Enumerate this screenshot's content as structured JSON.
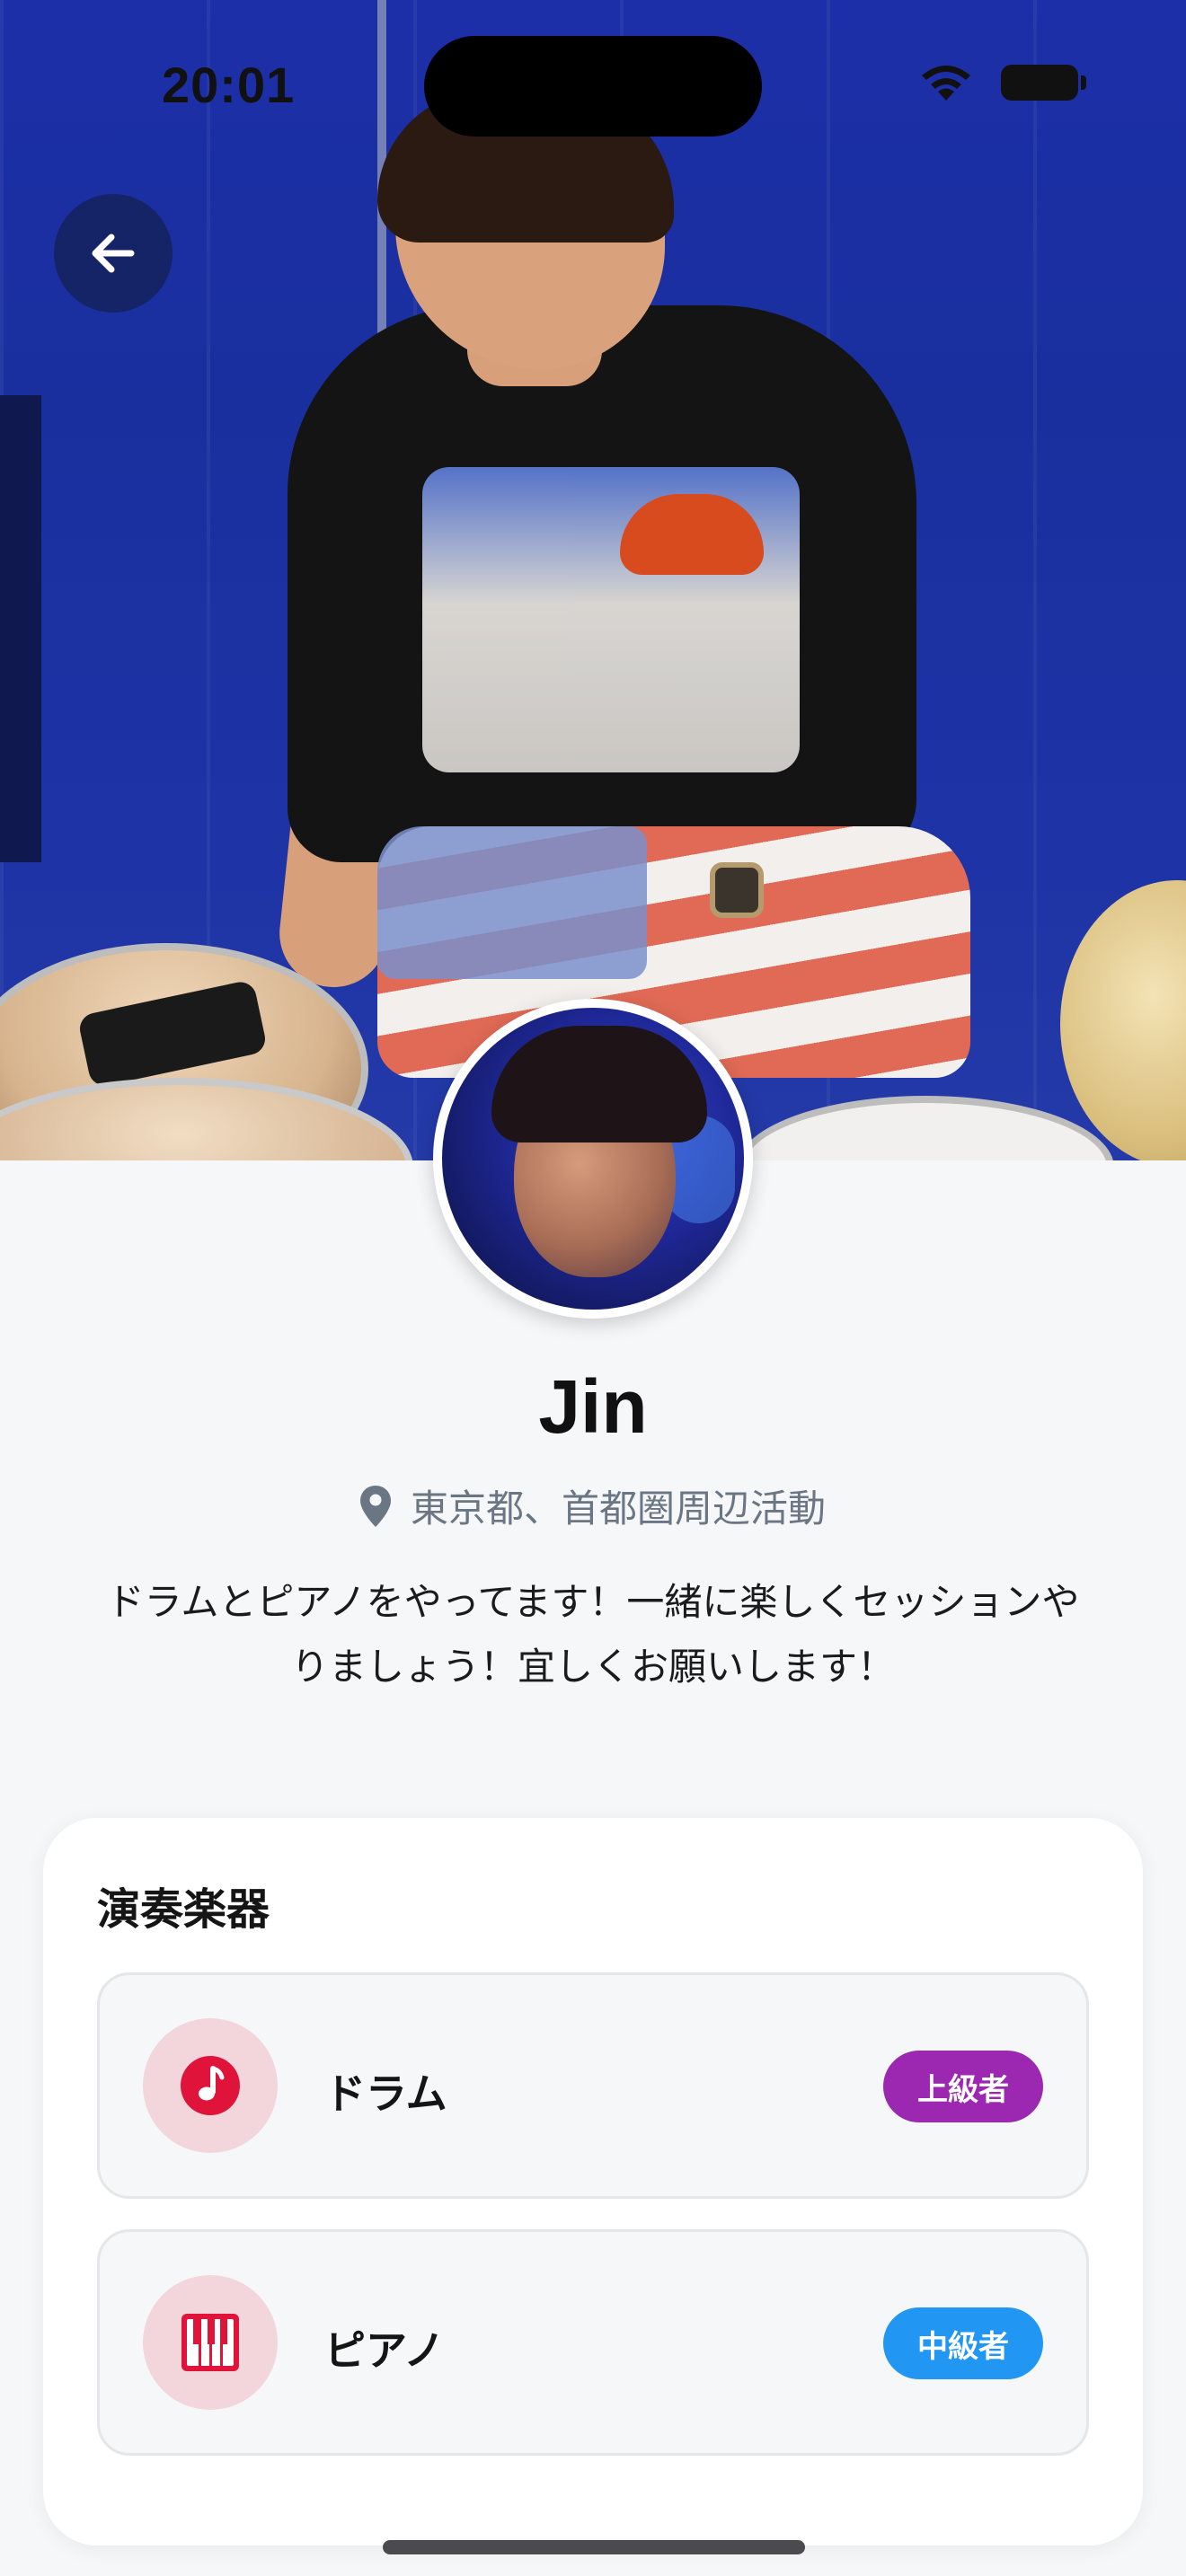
{
  "status_bar": {
    "time": "20:01"
  },
  "profile": {
    "name": "Jin",
    "location": "東京都、首都圏周辺活動",
    "bio": "ドラムとピアノをやってます！一緒に楽しくセッションやりましょう！宜しくお願いします！"
  },
  "instruments_section": {
    "title": "演奏楽器",
    "items": [
      {
        "name": "ドラム",
        "icon": "music-note-icon",
        "level": "上級者",
        "level_color": "#9c27b0"
      },
      {
        "name": "ピアノ",
        "icon": "piano-icon",
        "level": "中級者",
        "level_color": "#2196f3"
      }
    ]
  },
  "colors": {
    "accent_red": "#e0133b",
    "icon_bg": "#f3d6dc",
    "page_bg": "#f6f7f9"
  }
}
